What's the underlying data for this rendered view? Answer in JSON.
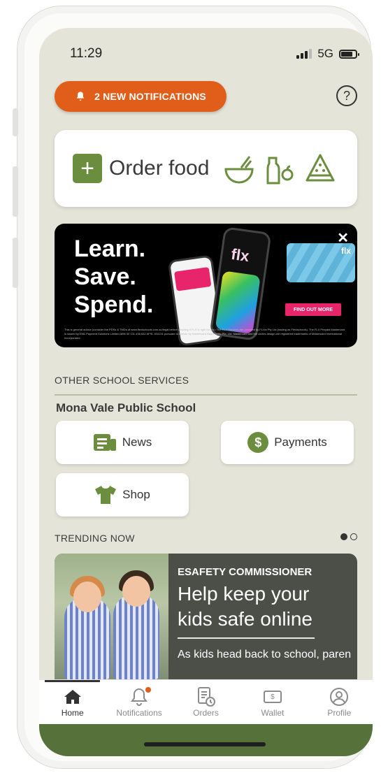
{
  "status_bar": {
    "time": "11:29",
    "network": "5G"
  },
  "header": {
    "notifications_label": "2 NEW NOTIFICATIONS",
    "help_icon_text": "?"
  },
  "order_card": {
    "plus_text": "+",
    "label": "Order food"
  },
  "banner": {
    "headline_lines": [
      "Learn.",
      "Save.",
      "Spend."
    ],
    "phone_logo": "flx",
    "card_logo": "flx",
    "cta": "FIND OUT MORE",
    "close_text": "✕",
    "fine_print": "This is general advice (consider the PDSs & TMDs at www.flexischools.com.au/legal before deciding if FLX is right for you. The FLX Services are provided by FLXin Pty Ltd (trading as Flexischools). The FLX Prepaid Mastercard is issued by EML Payment Solutions Limited ABN 30 131 436 532 AFSL 404131 pursuant to license by Mastercard Asia/Pacific Pte. Ltd. Mastercard and the circles design are registered trademarks of Mastercard International Incorporated."
  },
  "other_services": {
    "section_title": "OTHER SCHOOL SERVICES",
    "school_name": "Mona Vale Public School",
    "buttons": [
      {
        "label": "News",
        "icon": "newspaper-icon"
      },
      {
        "label": "Payments",
        "icon": "dollar-icon"
      },
      {
        "label": "Shop",
        "icon": "tshirt-icon"
      }
    ],
    "payments_icon_text": "$"
  },
  "trending": {
    "section_title": "TRENDING NOW",
    "carousel_pages": 2,
    "active_page": 1,
    "card": {
      "kicker": "ESAFETY COMMISSIONER",
      "title": "Help keep your kids safe online",
      "description": "As kids head back to school, parents and carers are prepp..."
    }
  },
  "bottom_nav": {
    "items": [
      {
        "label": "Home",
        "icon": "home-icon",
        "active": true
      },
      {
        "label": "Notifications",
        "icon": "bell-icon",
        "active": false,
        "has_badge": true
      },
      {
        "label": "Orders",
        "icon": "orders-icon",
        "active": false
      },
      {
        "label": "Wallet",
        "icon": "wallet-icon",
        "active": false
      },
      {
        "label": "Profile",
        "icon": "profile-icon",
        "active": false
      }
    ],
    "wallet_icon_text": "$"
  },
  "colors": {
    "background": "#e4e5d8",
    "accent_orange": "#e05e1a",
    "brand_green": "#6b8e3e",
    "footer_green": "#56723a",
    "trend_card": "#4b4f48",
    "banner_pink": "#e8246a"
  }
}
